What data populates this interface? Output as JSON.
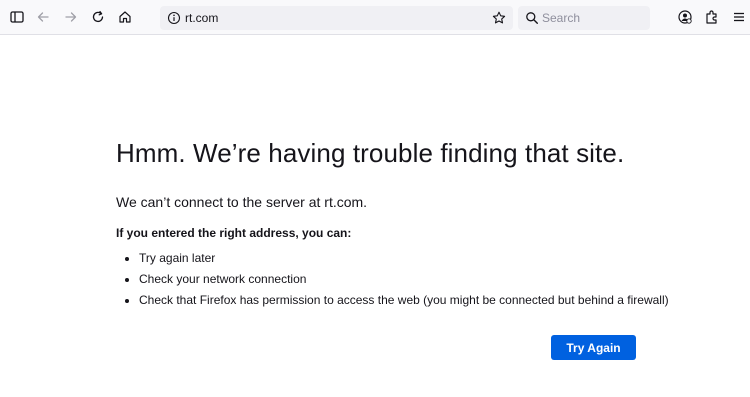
{
  "toolbar": {
    "url": "rt.com",
    "search_placeholder": "Search",
    "icons": [
      "sidebar-icon",
      "back-icon",
      "forward-icon",
      "reload-icon",
      "home-icon",
      "info-icon",
      "bookmark-star-icon",
      "search-icon",
      "account-icon",
      "extensions-icon",
      "menu-icon"
    ]
  },
  "error": {
    "title": "Hmm. We’re having trouble finding that site.",
    "message": "We can’t connect to the server at rt.com.",
    "subtitle": "If you entered the right address, you can:",
    "suggestions": [
      "Try again later",
      "Check your network connection",
      "Check that Firefox has permission to access the web (you might be connected but behind a firewall)"
    ],
    "button_label": "Try Again"
  },
  "colors": {
    "button": "#0061e0",
    "toolbar_bg": "#f9f9fb",
    "field_bg": "#f0f0f4"
  }
}
